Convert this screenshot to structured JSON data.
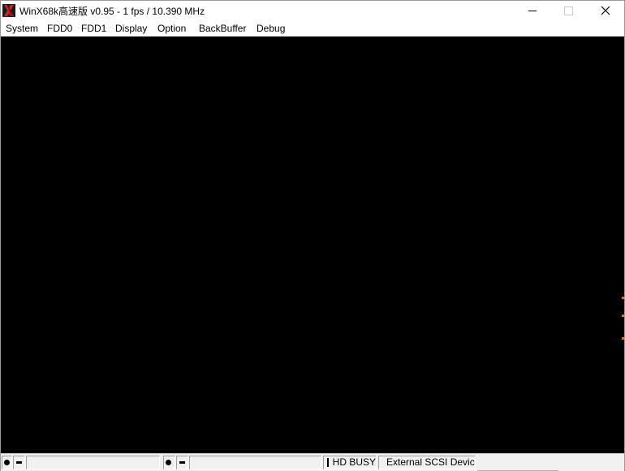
{
  "window": {
    "title": "WinX68k高速版 v0.95 - 1 fps / 10.390 MHz",
    "controls": {
      "minimize": "minimize-icon",
      "maximize": "maximize-icon",
      "close": "close-icon"
    }
  },
  "menu": [
    "System",
    "FDD0",
    "FDD1",
    "Display",
    "Option",
    "BackBuffer",
    "Debug"
  ],
  "screen": {
    "background": "#000000"
  },
  "statusbar": {
    "fdd0_name": "",
    "fdd1_name": "",
    "hd_label": "HD BUSY",
    "scsi_label": "External SCSI Device"
  },
  "colors": {
    "accent": "#cc1a1a",
    "screen": "#000000",
    "statusbar": "#f0f0f0"
  }
}
